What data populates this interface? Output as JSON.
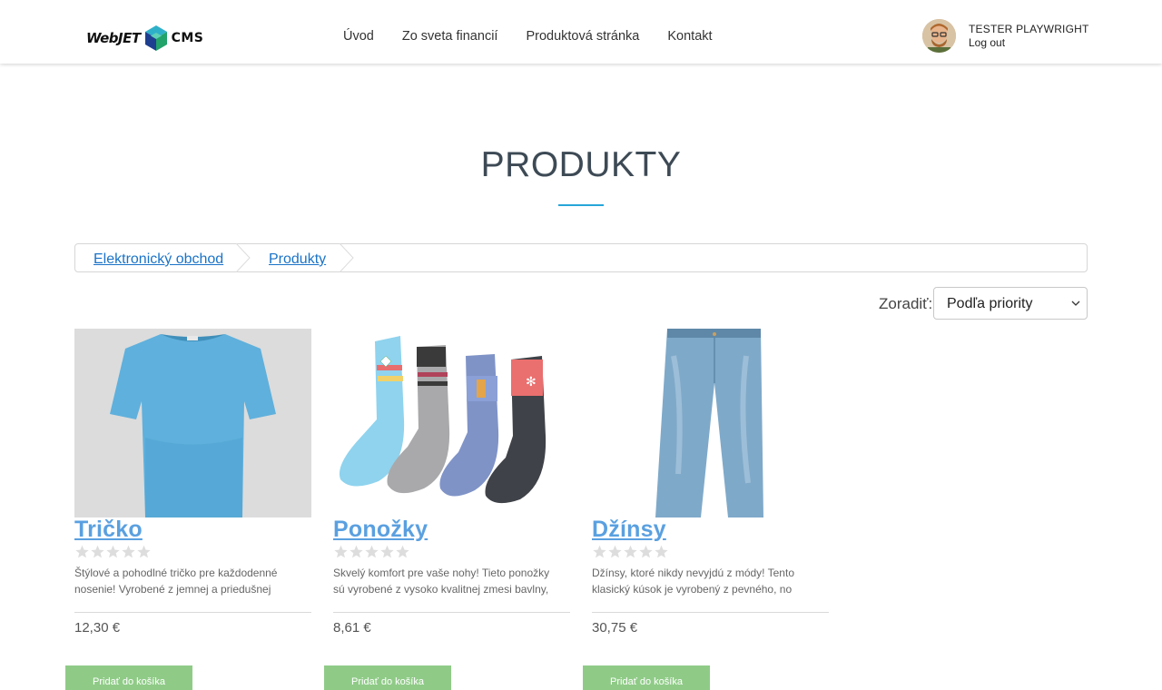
{
  "brand": {
    "logo_web": "WebJET",
    "logo_cms": "CMS"
  },
  "nav": {
    "items": [
      "Úvod",
      "Zo sveta financií",
      "Produktová stránka",
      "Kontakt"
    ]
  },
  "user": {
    "name": "TESTER PLAYWRIGHT",
    "logout": "Log out"
  },
  "page": {
    "title": "PRODUKTY"
  },
  "breadcrumb": {
    "items": [
      "Elektronický obchod",
      "Produkty"
    ]
  },
  "sort": {
    "label": "Zoradiť:",
    "selected": "Podľa priority"
  },
  "products": [
    {
      "name": "Tričko",
      "rating": 0,
      "description": "Štýlové a pohodlné tričko pre každodenné nosenie! Vyrobené z jemnej a priedušnej bavlny,",
      "price": "12,30 €",
      "button": "Pridať do košíka"
    },
    {
      "name": "Ponožky",
      "rating": 0,
      "description": "Skvelý komfort pre vaše nohy! Tieto ponožky sú vyrobené z vysoko kvalitnej zmesi bavlny, ktorá",
      "price": "8,61 €",
      "button": "Pridať do košíka"
    },
    {
      "name": "Džínsy",
      "rating": 0,
      "description": "Džínsy, ktoré nikdy nevyjdú z módy! Tento klasický kúsok je vyrobený z pevného, no",
      "price": "30,75 €",
      "button": "Pridať do košíka"
    }
  ],
  "colors": {
    "accent": "#27a6d9",
    "link": "#1a73c8",
    "title_link": "#5aa0e0",
    "cart_button": "#8fcb87",
    "star_empty": "#dddddd"
  },
  "icons": {
    "logo_cube": "cube-logo-icon",
    "star": "star-icon",
    "caret": "chevron-down-icon",
    "avatar": "user-avatar"
  }
}
